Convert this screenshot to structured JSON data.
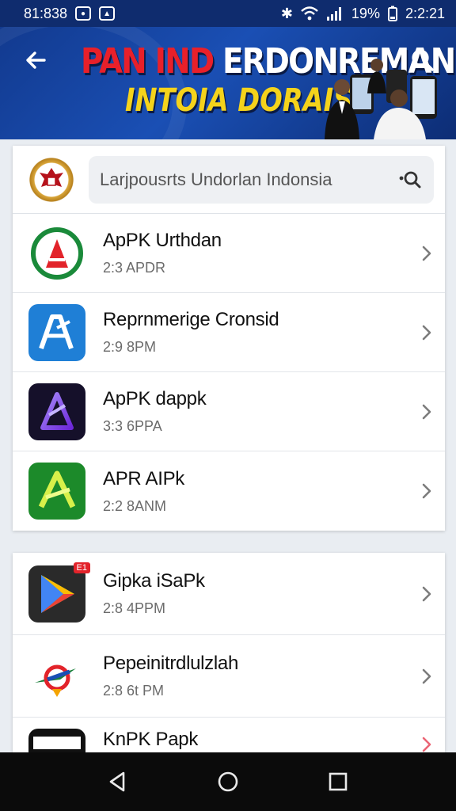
{
  "status_bar": {
    "time_left": "81:838",
    "battery": "19%",
    "clock": "2:2:21"
  },
  "header": {
    "title_line1_a": "PAN",
    "title_line1_b": "IND",
    "title_line1_c": "ERDONREMAN",
    "title_line2": "INTOIA DORAISI"
  },
  "search": {
    "placeholder": "Larjpousrts Undorlan Indonsia"
  },
  "icons": {
    "back": "back-arrow-icon",
    "search": "search-icon",
    "chevron": "chevron-right-icon"
  },
  "apps_group1": [
    {
      "title": "ApPK Urthdan",
      "time": "2:3 APDR"
    },
    {
      "title": "Reprnmerige Cronsid",
      "time": "2:9 8PM"
    },
    {
      "title": "ApPK dappk",
      "time": "3:3 6PPA"
    },
    {
      "title": "APR AIPk",
      "time": "2:2 8ANM"
    }
  ],
  "apps_group2": [
    {
      "title": "Gipka iSaPk",
      "time": "2:8 4PPM",
      "badge": "E1"
    },
    {
      "title": "Pepeinitrdlulzlah",
      "time": "2:8 6t PM"
    },
    {
      "title": "KnPK Papk",
      "time": ""
    }
  ],
  "colors": {
    "header_bg": "#123a8f",
    "title_red": "#e8202a",
    "title_yellow": "#f4d21c"
  }
}
